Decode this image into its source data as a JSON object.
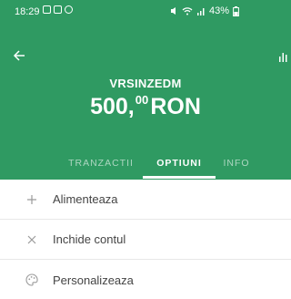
{
  "status_bar": {
    "time": "18:29",
    "battery": "43%"
  },
  "account": {
    "name": "VRSINZEDM",
    "balance_integer": "500,",
    "balance_decimals": "00",
    "currency": "RON"
  },
  "tabs": [
    {
      "label": "TRANZACTII",
      "active": false
    },
    {
      "label": "OPTIUNI",
      "active": true
    },
    {
      "label": "INFO",
      "active": false
    }
  ],
  "menu": {
    "items": [
      {
        "label": "Alimenteaza",
        "icon": "plus-icon"
      },
      {
        "label": "Inchide contul",
        "icon": "close-icon"
      },
      {
        "label": "Personalizeaza",
        "icon": "palette-icon"
      }
    ]
  },
  "colors": {
    "header_bg": "#2f9a62",
    "menu_icon": "#9a9a9a",
    "menu_text": "#444444"
  }
}
